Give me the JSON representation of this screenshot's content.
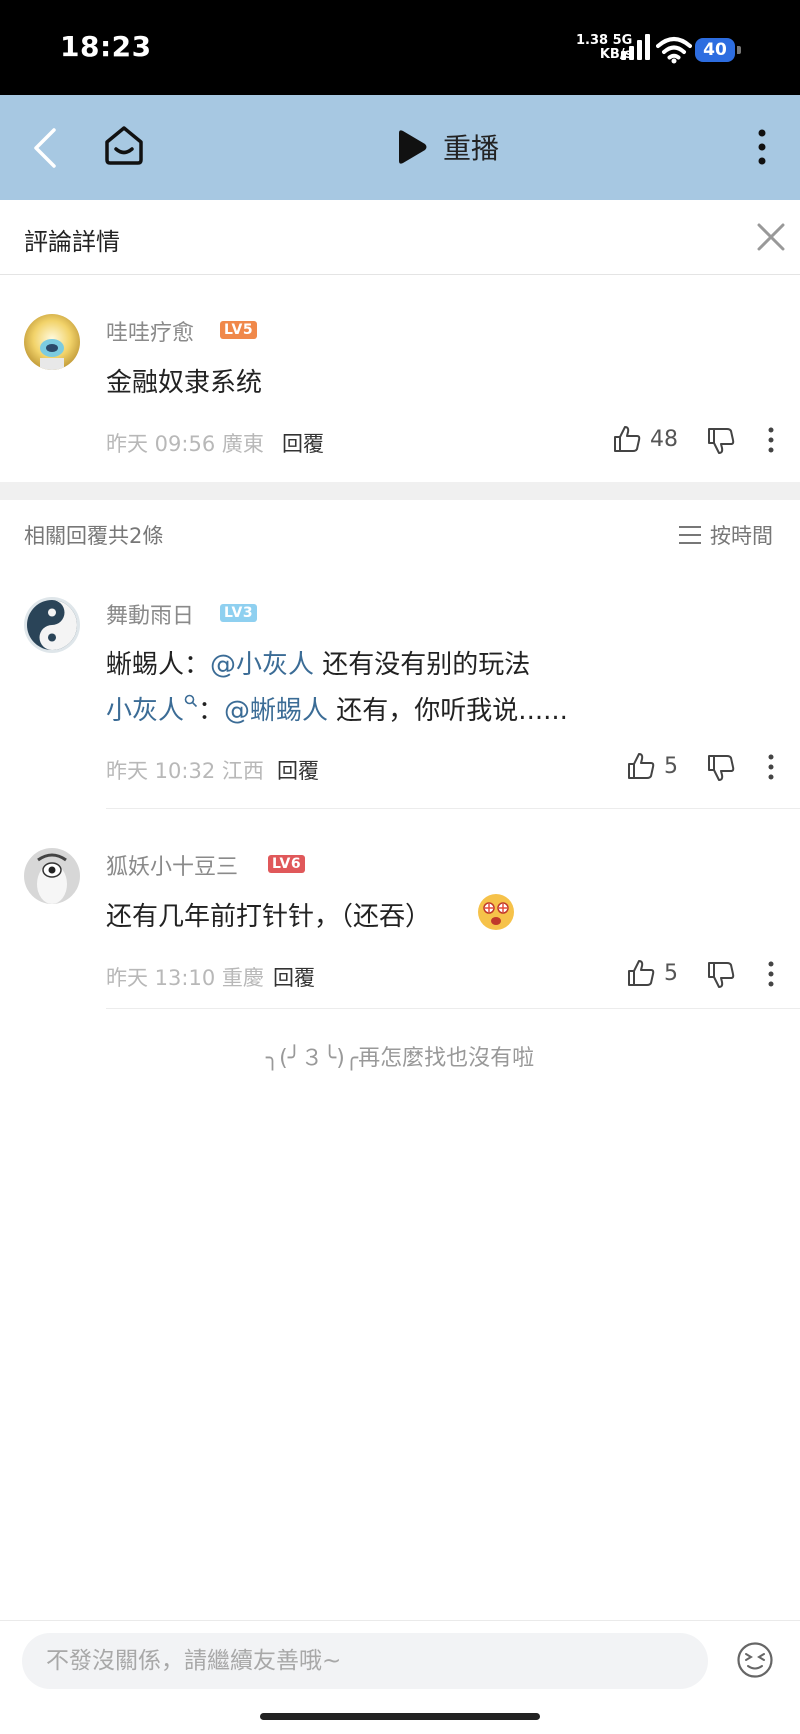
{
  "status_bar": {
    "time": "18:23",
    "speed_value": "1.38 5G",
    "speed_unit": "KB/s",
    "battery": "40"
  },
  "top_bar": {
    "replay_label": "重播"
  },
  "detail": {
    "title": "評論詳情"
  },
  "main_comment": {
    "username": "哇哇疗愈",
    "level": "LV5",
    "text": "金融奴隶系统",
    "time": "昨天 09:56 廣東",
    "reply_label": "回覆",
    "likes": "48"
  },
  "replies_header": {
    "count_label": "相關回覆共2條",
    "sort_label": "按時間"
  },
  "replies": [
    {
      "username": "舞動雨日",
      "level": "LV3",
      "line1_name": "蜥蜴人",
      "line1_colon": "：",
      "line1_mention": "@小灰人",
      "line1_text": " 还有没有别的玩法",
      "line2_name": "小灰人",
      "line2_colon": "：",
      "line2_mention": "@蜥蜴人",
      "line2_text": " 还有，你听我说......",
      "time": "昨天 10:32 江西",
      "reply_label": "回覆",
      "likes": "5"
    },
    {
      "username": "狐妖小十豆三",
      "level": "LV6",
      "text": "还有几年前打针针，（还吞）",
      "time": "昨天 13:10 重慶",
      "reply_label": "回覆",
      "likes": "5"
    }
  ],
  "end_note": "╮(╯３╰)╭再怎麼找也沒有啦",
  "input": {
    "placeholder": "不發沒關係，請繼續友善哦~"
  },
  "colors": {
    "top_bar_bg": "#a7c8e2",
    "mention": "#3b6c96",
    "lv5": "#f0884a",
    "lv3": "#8fd0f0",
    "lv6": "#e0585a"
  }
}
